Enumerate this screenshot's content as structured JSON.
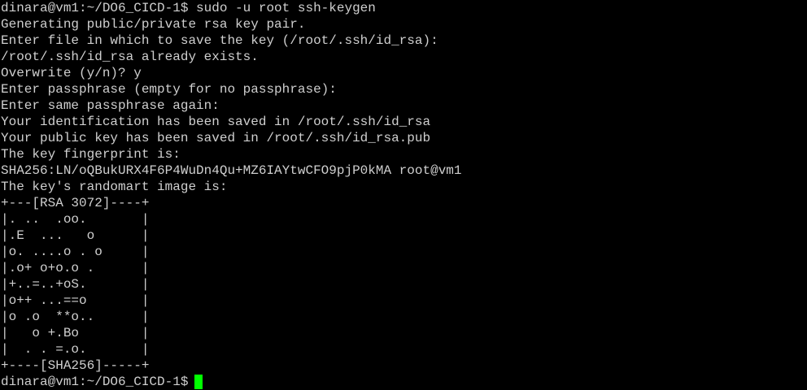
{
  "terminal": {
    "lines": [
      "dinara@vm1:~/DO6_CICD-1$ sudo -u root ssh-keygen",
      "Generating public/private rsa key pair.",
      "Enter file in which to save the key (/root/.ssh/id_rsa):",
      "/root/.ssh/id_rsa already exists.",
      "Overwrite (y/n)? y",
      "Enter passphrase (empty for no passphrase):",
      "Enter same passphrase again:",
      "Your identification has been saved in /root/.ssh/id_rsa",
      "Your public key has been saved in /root/.ssh/id_rsa.pub",
      "The key fingerprint is:",
      "SHA256:LN/oQBukURX4F6P4WuDn4Qu+MZ6IAYtwCFO9pjP0kMA root@vm1",
      "The key's randomart image is:",
      "+---[RSA 3072]----+",
      "|. ..  .oo.       |",
      "|.E  ...   o      |",
      "|o. ....o . o     |",
      "|.o+ o+o.o .      |",
      "|+..=..+oS.       |",
      "|o++ ...==o       |",
      "|o .o  **o..      |",
      "|   o +.Bo        |",
      "|  . . =.o.       |",
      "+----[SHA256]-----+"
    ],
    "prompt": "dinara@vm1:~/DO6_CICD-1$",
    "cursor_color": "#00ff00",
    "background_color": "#000000",
    "text_color": "#cfcfcf"
  }
}
